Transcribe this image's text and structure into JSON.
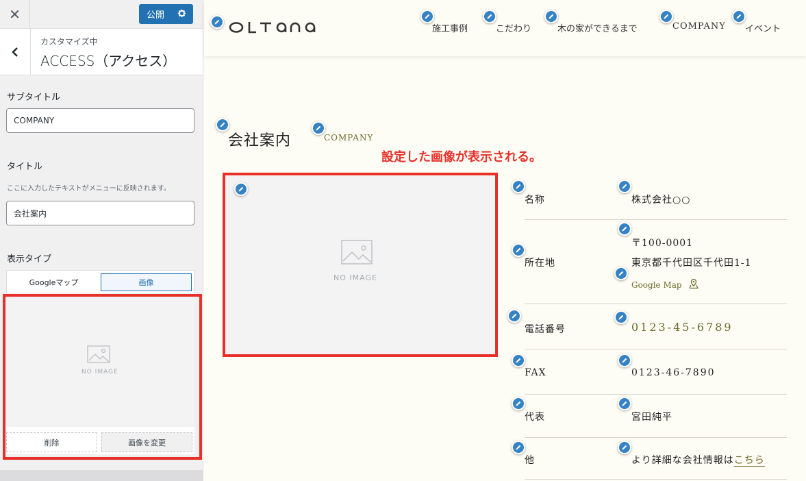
{
  "sidebar": {
    "publish_label": "公開",
    "crumb": "カスタマイズ中",
    "section_title": "ACCESS（アクセス）",
    "subtitle_label": "サブタイトル",
    "subtitle_value": "COMPANY",
    "title_label": "タイトル",
    "title_desc": "ここに入力したテキストがメニューに反映されます。",
    "title_value": "会社案内",
    "display_type_label": "表示タイプ",
    "tabs": {
      "gmap": "Googleマップ",
      "image": "画像"
    },
    "no_image": "NO IMAGE",
    "delete_label": "削除",
    "change_label": "画像を変更"
  },
  "site": {
    "nav": [
      "施工事例",
      "こだわり",
      "木の家ができるまで",
      "COMPANY",
      "イベント"
    ],
    "section_title": "会社案内",
    "section_sub": "COMPANY",
    "annotation": "設定した画像が表示される。",
    "no_image": "NO IMAGE",
    "info": {
      "name_label": "名称",
      "name_value": "株式会社○○",
      "address_label": "所在地",
      "zip": "〒100-0001",
      "address": "東京都千代田区千代田1-1",
      "gmap_link": "Google Map",
      "tel_label": "電話番号",
      "tel_value": "0123-45-6789",
      "fax_label": "FAX",
      "fax_value": "0123-46-7890",
      "rep_label": "代表",
      "rep_value": "宮田純平",
      "other_label": "他",
      "other_text": "より詳細な会社情報は",
      "other_link": "こちら"
    }
  },
  "colors": {
    "accent": "#2271b1",
    "annotation": "#e8302a",
    "brand_olive": "#6b6b2a"
  }
}
